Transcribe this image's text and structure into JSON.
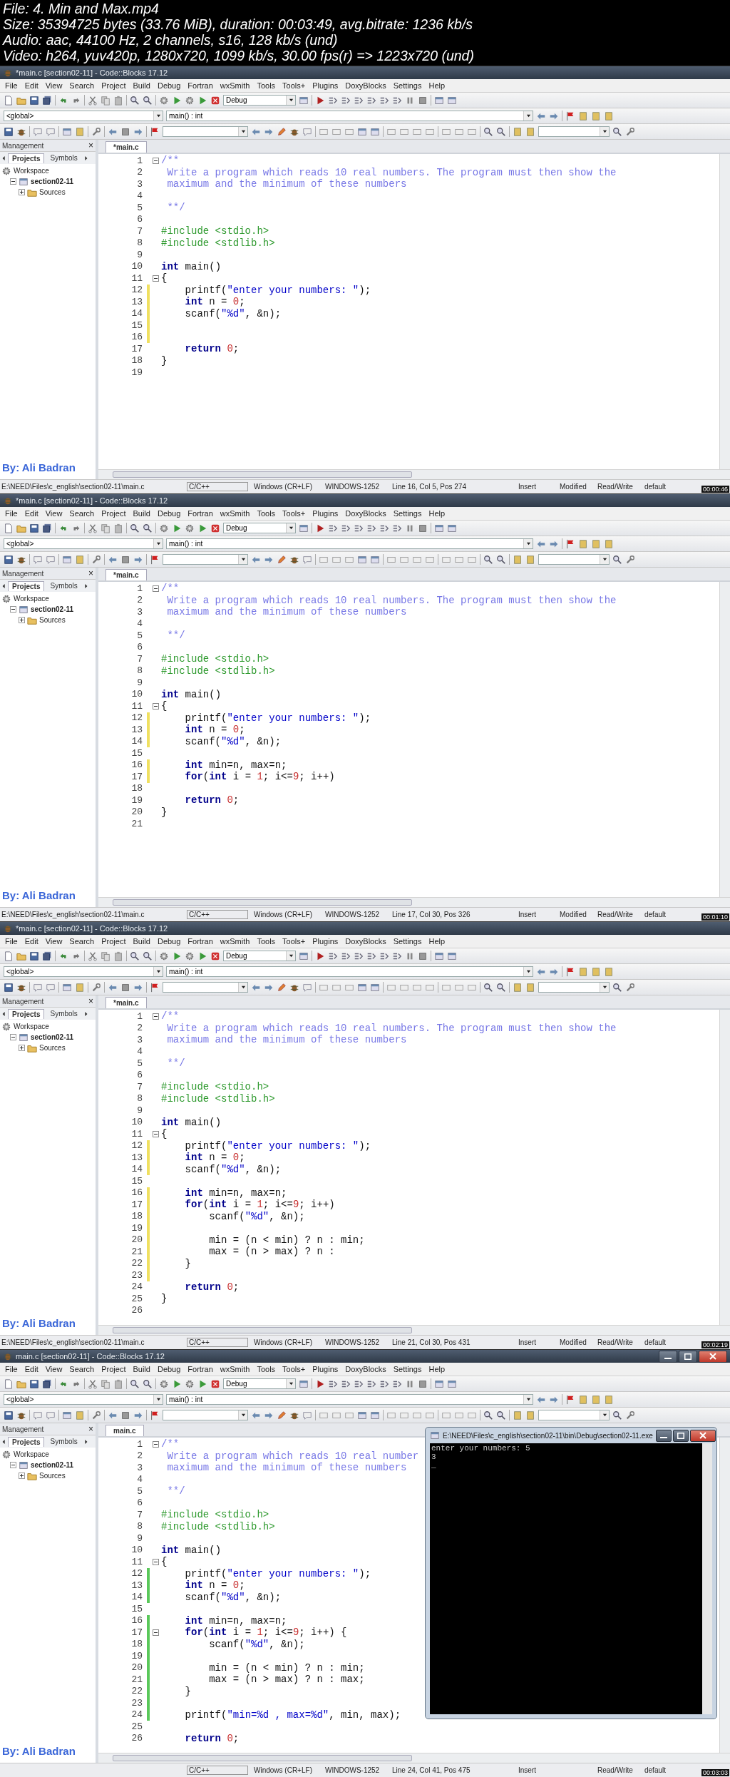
{
  "video_info": [
    "File: 4. Min and Max.mp4",
    "Size: 35394725 bytes (33.76 MiB), duration: 00:03:49, avg.bitrate: 1236 kb/s",
    "Audio: aac, 44100 Hz, 2 channels, s16, 128 kb/s (und)",
    "Video: h264, yuv420p, 1280x720, 1099 kb/s, 30.00 fps(r) => 1223x720 (und)"
  ],
  "frames": [
    {
      "window": {
        "title": "*main.c [section02-11] - Code::Blocks 17.12",
        "controls": false
      },
      "menu": [
        "File",
        "Edit",
        "View",
        "Search",
        "Project",
        "Build",
        "Debug",
        "Fortran",
        "wxSmith",
        "Tools",
        "Tools+",
        "Plugins",
        "DoxyBlocks",
        "Settings",
        "Help"
      ],
      "build_target": "Debug",
      "scope": "<global>",
      "function": "main() : int",
      "management": {
        "title": "Management",
        "close": "×",
        "tabs": [
          {
            "label": "Projects",
            "selected": true
          },
          {
            "label": "Symbols",
            "selected": false
          }
        ],
        "tree": [
          {
            "label": "Workspace",
            "children": [
              {
                "label": "section02-11",
                "expanded": true,
                "children": [
                  {
                    "label": "Sources",
                    "expanded": false
                  }
                ]
              }
            ]
          }
        ],
        "credit": "By: Ali Badran"
      },
      "editor_tabs": [
        {
          "label": "*main.c",
          "selected": true
        }
      ],
      "code": [
        {
          "number": "1",
          "foldable": true,
          "segments": [
            {
              "kind": "comment",
              "text": "/**"
            }
          ]
        },
        {
          "number": "2",
          "segments": [
            {
              "kind": "comment",
              "text": " Write a program which reads 10 real numbers. The program must then show the"
            }
          ]
        },
        {
          "number": "3",
          "segments": [
            {
              "kind": "comment",
              "text": " maximum and the minimum of these numbers"
            }
          ]
        },
        {
          "number": "4"
        },
        {
          "number": "5",
          "segments": [
            {
              "kind": "comment",
              "text": " **/"
            }
          ]
        },
        {
          "number": "6"
        },
        {
          "number": "7",
          "segments": [
            {
              "kind": "preprocessor",
              "text": "#include <stdio.h>"
            }
          ]
        },
        {
          "number": "8",
          "segments": [
            {
              "kind": "preprocessor",
              "text": "#include <stdlib.h>"
            }
          ]
        },
        {
          "number": "9"
        },
        {
          "number": "10",
          "segments": [
            {
              "kind": "keyword",
              "text": "int"
            },
            {
              "kind": "plain",
              "text": " main()"
            }
          ]
        },
        {
          "number": "11",
          "foldable": true,
          "segments": [
            {
              "kind": "plain",
              "text": "{"
            }
          ]
        },
        {
          "number": "12",
          "color": "#f0e060",
          "segments": [
            {
              "kind": "plain",
              "text": "    printf("
            },
            {
              "kind": "string",
              "text": "\"enter your numbers: \""
            },
            {
              "kind": "plain",
              "text": ");"
            }
          ]
        },
        {
          "number": "13",
          "color": "#f0e060",
          "segments": [
            {
              "kind": "keyword",
              "text": "    int"
            },
            {
              "kind": "plain",
              "text": " n = "
            },
            {
              "kind": "number",
              "text": "0"
            },
            {
              "kind": "plain",
              "text": ";"
            }
          ]
        },
        {
          "number": "14",
          "color": "#f0e060",
          "segments": [
            {
              "kind": "plain",
              "text": "    scanf("
            },
            {
              "kind": "string",
              "text": "\"%d\""
            },
            {
              "kind": "plain",
              "text": ", &n);"
            }
          ]
        },
        {
          "number": "15",
          "color": "#f0e060"
        },
        {
          "number": "16",
          "color": "#f0e060"
        },
        {
          "number": "17",
          "segments": [
            {
              "kind": "keyword",
              "text": "    return "
            },
            {
              "kind": "number",
              "text": "0"
            },
            {
              "kind": "plain",
              "text": ";"
            }
          ]
        },
        {
          "number": "18",
          "segments": [
            {
              "kind": "plain",
              "text": "}"
            }
          ]
        },
        {
          "number": "19"
        }
      ],
      "status_bar": {
        "path": "E:\\NEED\\Files\\c_english\\section02-11\\main.c",
        "language": "C/C++",
        "line_endings": "Windows (CR+LF)",
        "encoding": "WINDOWS-1252",
        "position": "Line 16, Col 5, Pos 274",
        "mode": "Insert",
        "modified": "Modified",
        "access": "Read/Write",
        "profile": "default"
      },
      "timestamp": "00:00:46"
    },
    {
      "window": {
        "title": "*main.c [section02-11] - Code::Blocks 17.12",
        "controls": false
      },
      "menu": [
        "File",
        "Edit",
        "View",
        "Search",
        "Project",
        "Build",
        "Debug",
        "Fortran",
        "wxSmith",
        "Tools",
        "Tools+",
        "Plugins",
        "DoxyBlocks",
        "Settings",
        "Help"
      ],
      "build_target": "Debug",
      "scope": "<global>",
      "function": "main() : int",
      "management": {
        "title": "Management",
        "close": "×",
        "tabs": [
          {
            "label": "Projects",
            "selected": true
          },
          {
            "label": "Symbols",
            "selected": false
          }
        ],
        "tree": [
          {
            "label": "Workspace",
            "children": [
              {
                "label": "section02-11",
                "expanded": true,
                "children": [
                  {
                    "label": "Sources",
                    "expanded": false
                  }
                ]
              }
            ]
          }
        ],
        "credit": "By: Ali Badran"
      },
      "editor_tabs": [
        {
          "label": "*main.c",
          "selected": true
        }
      ],
      "code": [
        {
          "number": "1",
          "foldable": true,
          "segments": [
            {
              "kind": "comment",
              "text": "/**"
            }
          ]
        },
        {
          "number": "2",
          "segments": [
            {
              "kind": "comment",
              "text": " Write a program which reads 10 real numbers. The program must then show the"
            }
          ]
        },
        {
          "number": "3",
          "segments": [
            {
              "kind": "comment",
              "text": " maximum and the minimum of these numbers"
            }
          ]
        },
        {
          "number": "4"
        },
        {
          "number": "5",
          "segments": [
            {
              "kind": "comment",
              "text": " **/"
            }
          ]
        },
        {
          "number": "6"
        },
        {
          "number": "7",
          "segments": [
            {
              "kind": "preprocessor",
              "text": "#include <stdio.h>"
            }
          ]
        },
        {
          "number": "8",
          "segments": [
            {
              "kind": "preprocessor",
              "text": "#include <stdlib.h>"
            }
          ]
        },
        {
          "number": "9"
        },
        {
          "number": "10",
          "segments": [
            {
              "kind": "keyword",
              "text": "int"
            },
            {
              "kind": "plain",
              "text": " main()"
            }
          ]
        },
        {
          "number": "11",
          "foldable": true,
          "segments": [
            {
              "kind": "plain",
              "text": "{"
            }
          ]
        },
        {
          "number": "12",
          "color": "#f0e060",
          "segments": [
            {
              "kind": "plain",
              "text": "    printf("
            },
            {
              "kind": "string",
              "text": "\"enter your numbers: \""
            },
            {
              "kind": "plain",
              "text": ");"
            }
          ]
        },
        {
          "number": "13",
          "color": "#f0e060",
          "segments": [
            {
              "kind": "keyword",
              "text": "    int"
            },
            {
              "kind": "plain",
              "text": " n = "
            },
            {
              "kind": "number",
              "text": "0"
            },
            {
              "kind": "plain",
              "text": ";"
            }
          ]
        },
        {
          "number": "14",
          "color": "#f0e060",
          "segments": [
            {
              "kind": "plain",
              "text": "    scanf("
            },
            {
              "kind": "string",
              "text": "\"%d\""
            },
            {
              "kind": "plain",
              "text": ", &n);"
            }
          ]
        },
        {
          "number": "15"
        },
        {
          "number": "16",
          "color": "#f0e060",
          "segments": [
            {
              "kind": "keyword",
              "text": "    int"
            },
            {
              "kind": "plain",
              "text": " min=n, max=n;"
            }
          ]
        },
        {
          "number": "17",
          "color": "#f0e060",
          "segments": [
            {
              "kind": "keyword",
              "text": "    for"
            },
            {
              "kind": "plain",
              "text": "("
            },
            {
              "kind": "keyword",
              "text": "int"
            },
            {
              "kind": "plain",
              "text": " i = "
            },
            {
              "kind": "number",
              "text": "1"
            },
            {
              "kind": "plain",
              "text": "; i<="
            },
            {
              "kind": "number",
              "text": "9"
            },
            {
              "kind": "plain",
              "text": "; i++)"
            }
          ]
        },
        {
          "number": "18"
        },
        {
          "number": "19",
          "segments": [
            {
              "kind": "keyword",
              "text": "    return "
            },
            {
              "kind": "number",
              "text": "0"
            },
            {
              "kind": "plain",
              "text": ";"
            }
          ]
        },
        {
          "number": "20",
          "segments": [
            {
              "kind": "plain",
              "text": "}"
            }
          ]
        },
        {
          "number": "21"
        }
      ],
      "status_bar": {
        "path": "E:\\NEED\\Files\\c_english\\section02-11\\main.c",
        "language": "C/C++",
        "line_endings": "Windows (CR+LF)",
        "encoding": "WINDOWS-1252",
        "position": "Line 17, Col 30, Pos 326",
        "mode": "Insert",
        "modified": "Modified",
        "access": "Read/Write",
        "profile": "default"
      },
      "timestamp": "00:01:10"
    },
    {
      "window": {
        "title": "*main.c [section02-11] - Code::Blocks 17.12",
        "controls": false
      },
      "menu": [
        "File",
        "Edit",
        "View",
        "Search",
        "Project",
        "Build",
        "Debug",
        "Fortran",
        "wxSmith",
        "Tools",
        "Tools+",
        "Plugins",
        "DoxyBlocks",
        "Settings",
        "Help"
      ],
      "build_target": "Debug",
      "scope": "<global>",
      "function": "main() : int",
      "management": {
        "title": "Management",
        "close": "×",
        "tabs": [
          {
            "label": "Projects",
            "selected": true
          },
          {
            "label": "Symbols",
            "selected": false
          }
        ],
        "tree": [
          {
            "label": "Workspace",
            "children": [
              {
                "label": "section02-11",
                "expanded": true,
                "children": [
                  {
                    "label": "Sources",
                    "expanded": false
                  }
                ]
              }
            ]
          }
        ],
        "credit": "By: Ali Badran"
      },
      "editor_tabs": [
        {
          "label": "*main.c",
          "selected": true
        }
      ],
      "code": [
        {
          "number": "1",
          "foldable": true,
          "segments": [
            {
              "kind": "comment",
              "text": "/**"
            }
          ]
        },
        {
          "number": "2",
          "segments": [
            {
              "kind": "comment",
              "text": " Write a program which reads 10 real numbers. The program must then show the"
            }
          ]
        },
        {
          "number": "3",
          "segments": [
            {
              "kind": "comment",
              "text": " maximum and the minimum of these numbers"
            }
          ]
        },
        {
          "number": "4"
        },
        {
          "number": "5",
          "segments": [
            {
              "kind": "comment",
              "text": " **/"
            }
          ]
        },
        {
          "number": "6"
        },
        {
          "number": "7",
          "segments": [
            {
              "kind": "preprocessor",
              "text": "#include <stdio.h>"
            }
          ]
        },
        {
          "number": "8",
          "segments": [
            {
              "kind": "preprocessor",
              "text": "#include <stdlib.h>"
            }
          ]
        },
        {
          "number": "9"
        },
        {
          "number": "10",
          "segments": [
            {
              "kind": "keyword",
              "text": "int"
            },
            {
              "kind": "plain",
              "text": " main()"
            }
          ]
        },
        {
          "number": "11",
          "foldable": true,
          "segments": [
            {
              "kind": "plain",
              "text": "{"
            }
          ]
        },
        {
          "number": "12",
          "color": "#f0e060",
          "segments": [
            {
              "kind": "plain",
              "text": "    printf("
            },
            {
              "kind": "string",
              "text": "\"enter your numbers: \""
            },
            {
              "kind": "plain",
              "text": ");"
            }
          ]
        },
        {
          "number": "13",
          "color": "#f0e060",
          "segments": [
            {
              "kind": "keyword",
              "text": "    int"
            },
            {
              "kind": "plain",
              "text": " n = "
            },
            {
              "kind": "number",
              "text": "0"
            },
            {
              "kind": "plain",
              "text": ";"
            }
          ]
        },
        {
          "number": "14",
          "color": "#f0e060",
          "segments": [
            {
              "kind": "plain",
              "text": "    scanf("
            },
            {
              "kind": "string",
              "text": "\"%d\""
            },
            {
              "kind": "plain",
              "text": ", &n);"
            }
          ]
        },
        {
          "number": "15"
        },
        {
          "number": "16",
          "color": "#f0e060",
          "segments": [
            {
              "kind": "keyword",
              "text": "    int"
            },
            {
              "kind": "plain",
              "text": " min=n, max=n;"
            }
          ]
        },
        {
          "number": "17",
          "color": "#f0e060",
          "segments": [
            {
              "kind": "keyword",
              "text": "    for"
            },
            {
              "kind": "plain",
              "text": "("
            },
            {
              "kind": "keyword",
              "text": "int"
            },
            {
              "kind": "plain",
              "text": " i = "
            },
            {
              "kind": "number",
              "text": "1"
            },
            {
              "kind": "plain",
              "text": "; i<="
            },
            {
              "kind": "number",
              "text": "9"
            },
            {
              "kind": "plain",
              "text": "; i++)"
            }
          ]
        },
        {
          "number": "18",
          "color": "#f0e060",
          "segments": [
            {
              "kind": "plain",
              "text": "        scanf("
            },
            {
              "kind": "string",
              "text": "\"%d\""
            },
            {
              "kind": "plain",
              "text": ", &n);"
            }
          ]
        },
        {
          "number": "19",
          "color": "#f0e060"
        },
        {
          "number": "20",
          "color": "#f0e060",
          "segments": [
            {
              "kind": "plain",
              "text": "        min = (n < min) ? n : min;"
            }
          ]
        },
        {
          "number": "21",
          "color": "#f0e060",
          "segments": [
            {
              "kind": "plain",
              "text": "        max = (n > max) ? n :"
            }
          ]
        },
        {
          "number": "22",
          "color": "#f0e060",
          "segments": [
            {
              "kind": "plain",
              "text": "    }"
            }
          ]
        },
        {
          "number": "23",
          "color": "#f0e060"
        },
        {
          "number": "24",
          "segments": [
            {
              "kind": "keyword",
              "text": "    return "
            },
            {
              "kind": "number",
              "text": "0"
            },
            {
              "kind": "plain",
              "text": ";"
            }
          ]
        },
        {
          "number": "25",
          "segments": [
            {
              "kind": "plain",
              "text": "}"
            }
          ]
        },
        {
          "number": "26"
        }
      ],
      "status_bar": {
        "path": "E:\\NEED\\Files\\c_english\\section02-11\\main.c",
        "language": "C/C++",
        "line_endings": "Windows (CR+LF)",
        "encoding": "WINDOWS-1252",
        "position": "Line 21, Col 30, Pos 431",
        "mode": "Insert",
        "modified": "Modified",
        "access": "Read/Write",
        "profile": "default"
      },
      "timestamp": "00:02:19"
    },
    {
      "window": {
        "title": "main.c [section02-11] - Code::Blocks 17.12",
        "controls": true
      },
      "menu": [
        "File",
        "Edit",
        "View",
        "Search",
        "Project",
        "Build",
        "Debug",
        "Fortran",
        "wxSmith",
        "Tools",
        "Tools+",
        "Plugins",
        "DoxyBlocks",
        "Settings",
        "Help"
      ],
      "build_target": "Debug",
      "scope": "<global>",
      "function": "main() : int",
      "management": {
        "title": "Management",
        "close": "×",
        "tabs": [
          {
            "label": "Projects",
            "selected": true
          },
          {
            "label": "Symbols",
            "selected": false
          }
        ],
        "tree": [
          {
            "label": "Workspace",
            "children": [
              {
                "label": "section02-11",
                "expanded": true,
                "children": [
                  {
                    "label": "Sources",
                    "expanded": false
                  }
                ]
              }
            ]
          }
        ],
        "credit": "By: Ali Badran"
      },
      "editor_tabs": [
        {
          "label": "main.c",
          "selected": true
        }
      ],
      "code": [
        {
          "number": "1",
          "foldable": true,
          "segments": [
            {
              "kind": "comment",
              "text": "/**"
            }
          ]
        },
        {
          "number": "2",
          "segments": [
            {
              "kind": "comment",
              "text": " Write a program which reads 10 real number"
            }
          ]
        },
        {
          "number": "3",
          "segments": [
            {
              "kind": "comment",
              "text": " maximum and the minimum of these numbers"
            }
          ]
        },
        {
          "number": "4"
        },
        {
          "number": "5",
          "segments": [
            {
              "kind": "comment",
              "text": " **/"
            }
          ]
        },
        {
          "number": "6"
        },
        {
          "number": "7",
          "segments": [
            {
              "kind": "preprocessor",
              "text": "#include <stdio.h>"
            }
          ]
        },
        {
          "number": "8",
          "segments": [
            {
              "kind": "preprocessor",
              "text": "#include <stdlib.h>"
            }
          ]
        },
        {
          "number": "9"
        },
        {
          "number": "10",
          "segments": [
            {
              "kind": "keyword",
              "text": "int"
            },
            {
              "kind": "plain",
              "text": " main()"
            }
          ]
        },
        {
          "number": "11",
          "foldable": true,
          "segments": [
            {
              "kind": "plain",
              "text": "{"
            }
          ]
        },
        {
          "number": "12",
          "color": "#5ac85a",
          "segments": [
            {
              "kind": "plain",
              "text": "    printf("
            },
            {
              "kind": "string",
              "text": "\"enter your numbers: \""
            },
            {
              "kind": "plain",
              "text": ");"
            }
          ]
        },
        {
          "number": "13",
          "color": "#5ac85a",
          "segments": [
            {
              "kind": "keyword",
              "text": "    int"
            },
            {
              "kind": "plain",
              "text": " n = "
            },
            {
              "kind": "number",
              "text": "0"
            },
            {
              "kind": "plain",
              "text": ";"
            }
          ]
        },
        {
          "number": "14",
          "color": "#5ac85a",
          "segments": [
            {
              "kind": "plain",
              "text": "    scanf("
            },
            {
              "kind": "string",
              "text": "\"%d\""
            },
            {
              "kind": "plain",
              "text": ", &n);"
            }
          ]
        },
        {
          "number": "15"
        },
        {
          "number": "16",
          "color": "#5ac85a",
          "segments": [
            {
              "kind": "keyword",
              "text": "    int"
            },
            {
              "kind": "plain",
              "text": " min=n, max=n;"
            }
          ]
        },
        {
          "number": "17",
          "foldable": true,
          "color": "#5ac85a",
          "segments": [
            {
              "kind": "keyword",
              "text": "    for"
            },
            {
              "kind": "plain",
              "text": "("
            },
            {
              "kind": "keyword",
              "text": "int"
            },
            {
              "kind": "plain",
              "text": " i = "
            },
            {
              "kind": "number",
              "text": "1"
            },
            {
              "kind": "plain",
              "text": "; i<="
            },
            {
              "kind": "number",
              "text": "9"
            },
            {
              "kind": "plain",
              "text": "; i++) {"
            }
          ]
        },
        {
          "number": "18",
          "color": "#5ac85a",
          "segments": [
            {
              "kind": "plain",
              "text": "        scanf("
            },
            {
              "kind": "string",
              "text": "\"%d\""
            },
            {
              "kind": "plain",
              "text": ", &n);"
            }
          ]
        },
        {
          "number": "19",
          "color": "#5ac85a"
        },
        {
          "number": "20",
          "color": "#5ac85a",
          "segments": [
            {
              "kind": "plain",
              "text": "        min = (n < min) ? n : min;"
            }
          ]
        },
        {
          "number": "21",
          "color": "#5ac85a",
          "segments": [
            {
              "kind": "plain",
              "text": "        max = (n > max) ? n : max;"
            }
          ]
        },
        {
          "number": "22",
          "color": "#5ac85a",
          "segments": [
            {
              "kind": "plain",
              "text": "    }"
            }
          ]
        },
        {
          "number": "23",
          "color": "#5ac85a"
        },
        {
          "number": "24",
          "color": "#5ac85a",
          "segments": [
            {
              "kind": "plain",
              "text": "    printf("
            },
            {
              "kind": "string",
              "text": "\"min=%d , max=%d\""
            },
            {
              "kind": "plain",
              "text": ", min, max);"
            }
          ]
        },
        {
          "number": "25"
        },
        {
          "number": "26",
          "segments": [
            {
              "kind": "keyword",
              "text": "    return "
            },
            {
              "kind": "number",
              "text": "0"
            },
            {
              "kind": "plain",
              "text": ";"
            }
          ]
        }
      ],
      "status_bar": {
        "language": "C/C++",
        "line_endings": "Windows (CR+LF)",
        "encoding": "WINDOWS-1252",
        "position": "Line 24, Col 41, Pos 475",
        "mode": "Insert",
        "access": "Read/Write",
        "profile": "default"
      },
      "console": {
        "title": "E:\\NEED\\Files\\c_english\\section02-11\\bin\\Debug\\section02-11.exe",
        "lines": [
          "enter your numbers: 5",
          "3",
          "_"
        ]
      },
      "timestamp": "00:03:03"
    }
  ]
}
